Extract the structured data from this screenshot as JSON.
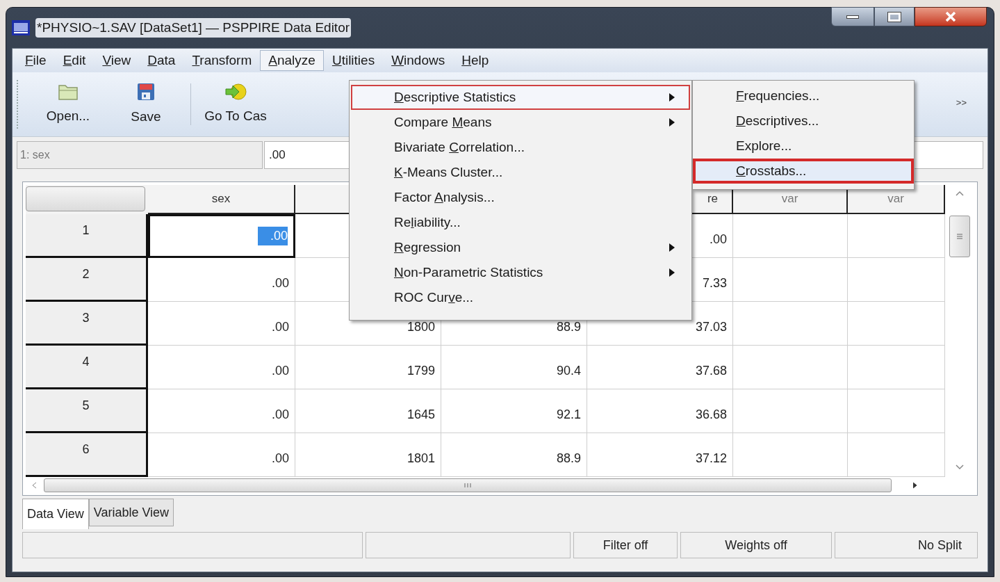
{
  "window": {
    "title": "*PHYSIO~1.SAV [DataSet1] — PSPPIRE Data Editor"
  },
  "menubar": [
    {
      "key": "F",
      "post": "ile",
      "selected": false
    },
    {
      "key": "E",
      "post": "dit",
      "selected": false
    },
    {
      "key": "V",
      "post": "iew",
      "selected": false
    },
    {
      "key": "D",
      "post": "ata",
      "selected": false
    },
    {
      "key": "T",
      "post": "ransform",
      "selected": false
    },
    {
      "key": "A",
      "post": "nalyze",
      "selected": true
    },
    {
      "key": "U",
      "post": "tilities",
      "selected": false
    },
    {
      "key": "W",
      "post": "indows",
      "selected": false
    },
    {
      "key": "H",
      "post": "elp",
      "selected": false
    }
  ],
  "toolbar": {
    "buttons": [
      {
        "kind": "open",
        "label": "Open..."
      },
      {
        "kind": "save",
        "label": "Save"
      },
      {
        "kind": "goto",
        "label": "Go To Cas"
      }
    ],
    "overflow": ">>"
  },
  "cell_reference": {
    "name": "1: sex",
    "value": ".00"
  },
  "grid": {
    "columns": [
      {
        "label": "sex",
        "cut": false
      },
      null,
      null,
      {
        "label": "re",
        "cut": true
      },
      {
        "label": "var",
        "cut": false
      },
      {
        "label": "var",
        "cut": false
      }
    ],
    "rows": [
      {
        "label": "1",
        "cells": [
          {
            "text": ".00",
            "selected": true
          },
          null,
          null,
          {
            "text": ".00",
            "selected": false
          },
          null,
          null
        ]
      },
      {
        "label": "2",
        "cells": [
          {
            "text": ".00",
            "selected": false
          },
          null,
          null,
          {
            "text": "7.33",
            "selected": false
          },
          null,
          null
        ]
      },
      {
        "label": "3",
        "cells": [
          {
            "text": ".00",
            "selected": false
          },
          {
            "text": "1800",
            "selected": false
          },
          {
            "text": "88.9",
            "selected": false
          },
          {
            "text": "37.03",
            "selected": false
          },
          null,
          null
        ]
      },
      {
        "label": "4",
        "cells": [
          {
            "text": ".00",
            "selected": false
          },
          {
            "text": "1799",
            "selected": false
          },
          {
            "text": "90.4",
            "selected": false
          },
          {
            "text": "37.68",
            "selected": false
          },
          null,
          null
        ]
      },
      {
        "label": "5",
        "cells": [
          {
            "text": ".00",
            "selected": false
          },
          {
            "text": "1645",
            "selected": false
          },
          {
            "text": "92.1",
            "selected": false
          },
          {
            "text": "36.68",
            "selected": false
          },
          null,
          null
        ]
      },
      {
        "label": "6",
        "cells": [
          {
            "text": ".00",
            "selected": false
          },
          {
            "text": "1801",
            "selected": false
          },
          {
            "text": "88.9",
            "selected": false
          },
          {
            "text": "37.12",
            "selected": false
          },
          null,
          null
        ]
      }
    ]
  },
  "analyze_menu": [
    {
      "key": "D",
      "post": "escriptive Statistics",
      "submenu": true,
      "selected": true
    },
    {
      "pre": "Compare ",
      "key": "M",
      "post": "eans",
      "submenu": true,
      "selected": false
    },
    {
      "pre": "Bivariate ",
      "key": "C",
      "post": "orrelation...",
      "submenu": false,
      "selected": false
    },
    {
      "key": "K",
      "post": "-Means Cluster...",
      "submenu": false,
      "selected": false
    },
    {
      "pre": "Factor ",
      "key": "A",
      "post": "nalysis...",
      "submenu": false,
      "selected": false
    },
    {
      "pre": "Re",
      "key": "l",
      "post": "iability...",
      "submenu": false,
      "selected": false
    },
    {
      "key": "R",
      "post": "egression",
      "submenu": true,
      "selected": false
    },
    {
      "key": "N",
      "post": "on-Parametric Statistics",
      "submenu": true,
      "selected": false
    },
    {
      "pre": "ROC Cur",
      "key": "v",
      "post": "e...",
      "submenu": false,
      "selected": false
    }
  ],
  "descriptive_submenu": [
    {
      "key": "F",
      "post": "requencies...",
      "selected": false
    },
    {
      "key": "D",
      "post": "escriptives...",
      "selected": false
    },
    {
      "pre": "Explore...",
      "selected": false
    },
    {
      "key": "C",
      "post": "rosstabs...",
      "selected": true
    }
  ],
  "tabs": [
    {
      "label": "Data View",
      "selected": true
    },
    {
      "label": "Variable View",
      "selected": false
    }
  ],
  "status_bar": [
    "Filter off",
    "Weights off",
    "No Split"
  ]
}
